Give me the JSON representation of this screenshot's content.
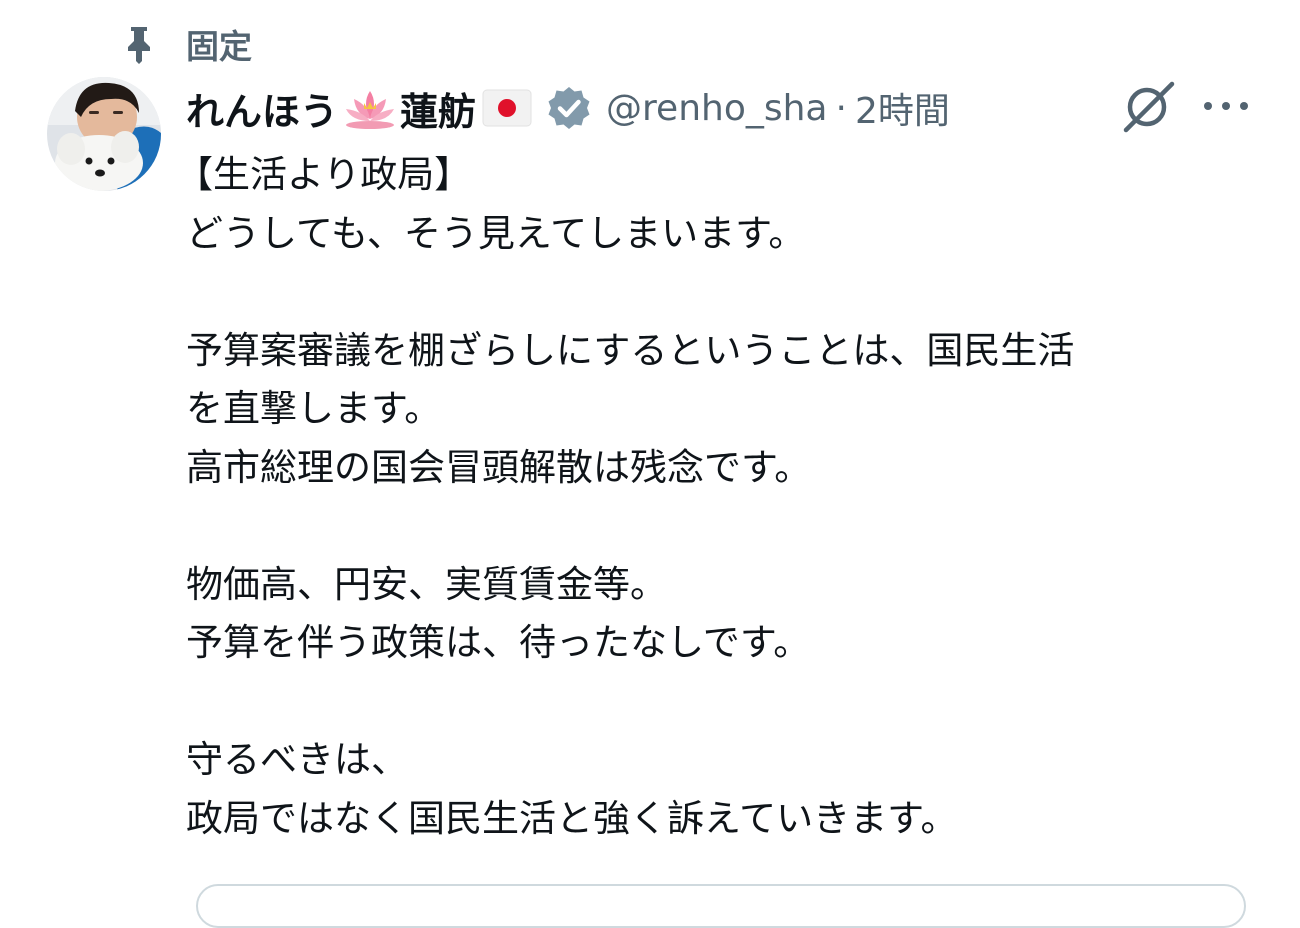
{
  "pinned": {
    "icon": "pin-icon",
    "label": "固定"
  },
  "author": {
    "display_name_part1": "れんほう",
    "emoji_1": "lotus-emoji",
    "display_name_part2": "蓮舫",
    "emoji_2": "japan-flag-emoji",
    "verified_icon": "verified-badge-icon",
    "verified_color": "#829aab",
    "handle": "@renho_sha",
    "separator": "·",
    "timestamp": "2時間"
  },
  "actions": {
    "grok_icon": "grok-icon",
    "more_icon": "more-options-icon"
  },
  "tweet": {
    "lines": [
      "【生活より政局】",
      "どうしても、そう見えてしまいます。",
      "",
      "予算案審議を棚ざらしにするということは、国民生活",
      "を直撃します。",
      "高市総理の国会冒頭解散は残念です。",
      "",
      "物価高、円安、実質賃金等。",
      "予算を伴う政策は、待ったなしです。",
      "",
      "守るべきは、",
      "政局ではなく国民生活と強く訴えていきます。"
    ]
  },
  "colors": {
    "text_primary": "#0f1419",
    "text_secondary": "#536471",
    "border": "#cfd9de"
  }
}
